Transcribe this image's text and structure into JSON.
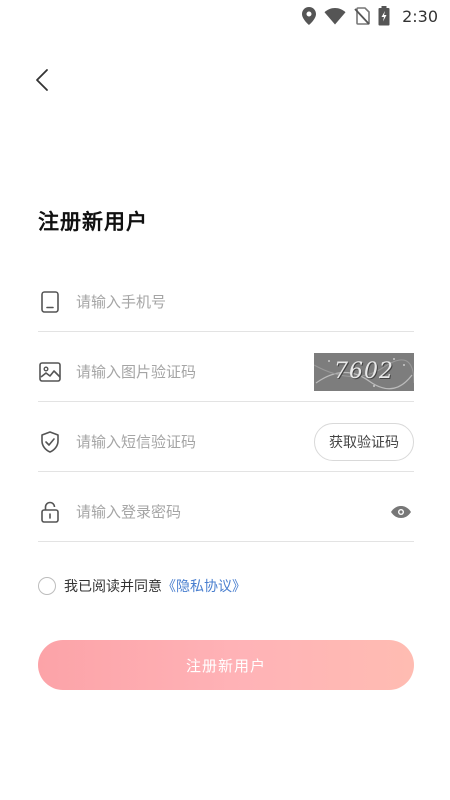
{
  "status_bar": {
    "time": "2:30",
    "icons": [
      "location-icon",
      "wifi-icon",
      "no-sim-icon",
      "battery-charging-icon"
    ]
  },
  "header": {
    "back_icon": "chevron-left-icon"
  },
  "page": {
    "title": "注册新用户"
  },
  "form": {
    "phone": {
      "icon": "phone-icon",
      "placeholder": "请输入手机号",
      "value": ""
    },
    "image_code": {
      "icon": "image-icon",
      "placeholder": "请输入图片验证码",
      "value": "",
      "captcha_text": "7602"
    },
    "sms_code": {
      "icon": "shield-check-icon",
      "placeholder": "请输入短信验证码",
      "value": "",
      "get_code_label": "获取验证码"
    },
    "password": {
      "icon": "lock-icon",
      "placeholder": "请输入登录密码",
      "value": "",
      "toggle_icon": "eye-icon"
    }
  },
  "agreement": {
    "checked": false,
    "text": "我已阅读并同意",
    "link_text": "《隐私协议》",
    "link_color": "#4a7fcf"
  },
  "submit": {
    "label": "注册新用户",
    "gradient_start": "#fca3a8",
    "gradient_end": "#ffbcb2"
  }
}
